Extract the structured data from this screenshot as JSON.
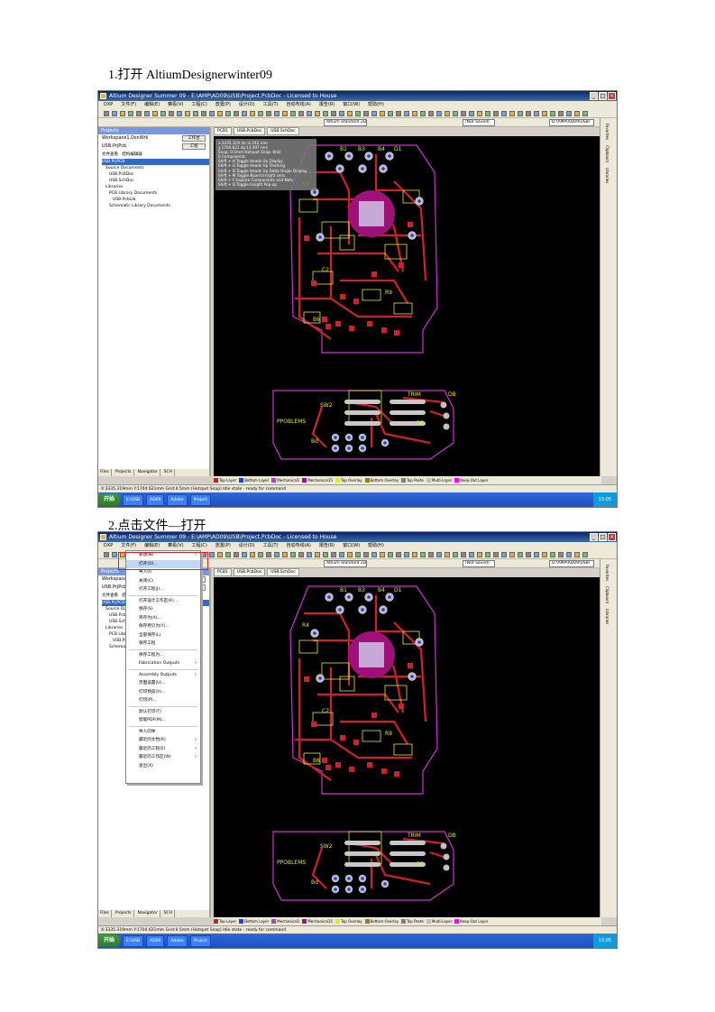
{
  "steps": [
    {
      "caption": "1.打开 AltiumDesignerwinter09"
    },
    {
      "caption": "2.点击文件—打开"
    }
  ],
  "window": {
    "title": "Altium Designer Summer 09 - E:\\AMP\\AD09\\USB\\Project.PcbDoc - Licensed to House",
    "min": "_",
    "max": "□",
    "close": "×"
  },
  "menubar": [
    "DXP",
    "文件(F)",
    "编辑(E)",
    "察看(V)",
    "工程(C)",
    "放置(P)",
    "设计(D)",
    "工具(T)",
    "自动布线(A)",
    "报告(R)",
    "窗口(W)",
    "帮助(H)"
  ],
  "toolbar": {
    "field1": "Altium Standard 2D",
    "field2": "(Not Saved)",
    "field3": "D:\\AMP\\AD09\\USB\\"
  },
  "doc_tabs": [
    "PCB1",
    "USB.PcbDoc",
    "USB.SchDoc"
  ],
  "panel": {
    "title": "Projects",
    "workspace": "Workspace1.DsnWrk",
    "workspace_btn": "工作台",
    "project": "USB.PrjPcb",
    "project_btn": "工程",
    "view_file": "文件查看",
    "view_struct": "结构编辑器",
    "tree": [
      "USB.PrjPCB",
      "Source Documents",
      "USB.PcbDoc",
      "USB.SchDoc",
      "Libraries",
      "PCB Library Documents",
      "USB.PcbLib",
      "Schematic Library Documents"
    ],
    "tabs": [
      "Files",
      "Projects",
      "Navigator",
      "SCH"
    ]
  },
  "hud": [
    "x:3335.319   dx:-4.242 mm",
    "y:1704.621   dy:13.497 mm",
    "Snap: 0.5mm Hotspot Snap: 8mil",
    "0 Components",
    "Shift + H  Toggle Heads Up Display",
    "Shift + G  Toggle Heads Up Tracking",
    "Shift + D  Toggle Heads Up Delta Origin Display",
    "Shift + M  Toggle Board Insight Lens",
    "Shift + F  Explore Components and Nets",
    "Shift + Q  Toggle Insight Pop-up"
  ],
  "layers": [
    {
      "name": "Top Layer",
      "color": "#cc2020"
    },
    {
      "name": "Bottom Layer",
      "color": "#1a3cff"
    },
    {
      "name": "Mechanical1",
      "color": "#cc33cc"
    },
    {
      "name": "Mechanical15",
      "color": "#aa00aa"
    },
    {
      "name": "Top Overlay",
      "color": "#e6e62e"
    },
    {
      "name": "Bottom Overlay",
      "color": "#a08000"
    },
    {
      "name": "Top Paste",
      "color": "#808080"
    },
    {
      "name": "Multi-Layer",
      "color": "#c0c0c0"
    },
    {
      "name": "Keep-Out Layer",
      "color": "#ff00ff"
    }
  ],
  "status_bar": "X:3335.319mm Y:1704.621mm  Grid:0.5mm  (Hotspot Snap)  Idle state - ready for command",
  "right_strip": [
    "Favorites",
    "Clipboard",
    "Libraries"
  ],
  "taskbar": {
    "start": "开始",
    "items": [
      "E:\\USB",
      "AD09",
      "Adobe",
      "Project"
    ],
    "clock": "13:05"
  },
  "file_menu": {
    "items": [
      {
        "label": "新建(N)",
        "arrow": true
      },
      {
        "label": "打开(O)...",
        "arrow": false
      },
      {
        "label": "导入(I)",
        "arrow": false
      },
      {
        "label": "关闭(C)",
        "arrow": false
      },
      {
        "label": "打开工程(J)...",
        "arrow": false
      },
      {
        "label": "打开设计工作区(K)...",
        "arrow": false
      },
      {
        "label": "保存(S)",
        "arrow": false
      },
      {
        "label": "另存为(A)...",
        "arrow": false
      },
      {
        "label": "保存拷贝为(Y)...",
        "arrow": false
      },
      {
        "label": "全部保存(L)",
        "arrow": false
      },
      {
        "label": "保存工程",
        "arrow": false
      },
      {
        "label": "保存工程为...",
        "arrow": false
      },
      {
        "label": "Fabrication Outputs",
        "arrow": true
      },
      {
        "label": "Assembly Outputs",
        "arrow": true
      },
      {
        "label": "页面设置(U)...",
        "arrow": false
      },
      {
        "label": "打印预览(V)...",
        "arrow": false
      },
      {
        "label": "打印(P)...",
        "arrow": false
      },
      {
        "label": "默认打印(T)",
        "arrow": false
      },
      {
        "label": "智能PDF(M)...",
        "arrow": false
      },
      {
        "label": "导入向导",
        "arrow": false
      },
      {
        "label": "最近的文档(R)",
        "arrow": true
      },
      {
        "label": "最近的工程(E)",
        "arrow": true
      },
      {
        "label": "最近的工作区(W)",
        "arrow": true
      },
      {
        "label": "退出(X)",
        "arrow": false
      }
    ]
  },
  "pcb_labels": [
    "B1",
    "B3",
    "B4",
    "D1",
    "R4",
    "C2",
    "R9",
    "B6",
    "SW2",
    "PPOBLEMS",
    "Bd",
    "TRIM",
    "PE",
    "DB"
  ]
}
